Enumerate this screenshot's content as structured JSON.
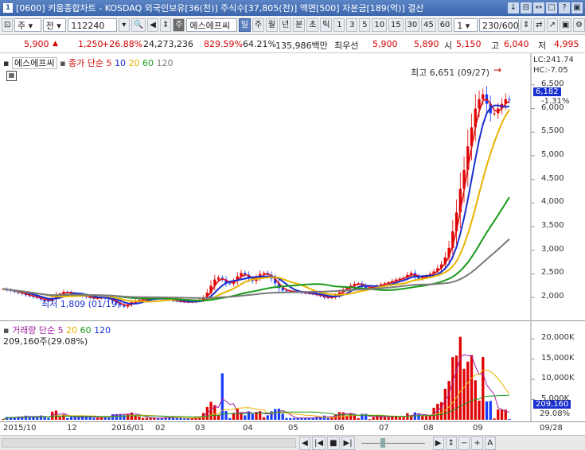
{
  "window": {
    "badge": "1",
    "title": "[0600] 키움종합차트 - KOSDAQ 외국인보유[36(천)] 주식수[37,805(천)] 액면[500] 자본금[189(억)] 결산",
    "buttons": [
      "↓",
      "⊟",
      "↔",
      "□",
      "?",
      "▣"
    ]
  },
  "toolbar": {
    "type_select": "주",
    "jeon_select": "전",
    "code": "112240",
    "company_tag": "주",
    "company": "에스에프씨",
    "periods": [
      "일",
      "주",
      "월",
      "년",
      "분",
      "초",
      "틱"
    ],
    "active_period": "일",
    "intervals": [
      "1",
      "3",
      "5",
      "10",
      "15",
      "30",
      "45",
      "60"
    ],
    "interval_value": "1",
    "count": "230/600"
  },
  "quote": {
    "price": "5,900",
    "change_arrow": "▲",
    "change": "1,250",
    "change_pct": "+26.88%",
    "volume": "24,273,236",
    "vol_ratio": "829.59%",
    "turnover": "64.21%",
    "amount": "135,986백만",
    "best_label": "최우선",
    "bid1": "5,900",
    "bid2": "5,890",
    "open_label": "시",
    "open": "5,150",
    "high_label": "고",
    "high": "6,040",
    "low_label": "저",
    "low": "4,995"
  },
  "price_panel": {
    "stock_name": "에스에프씨",
    "legend_label": "종가 단순",
    "ma_periods": [
      "5",
      "10",
      "20",
      "60",
      "120"
    ],
    "lc": "LC:241.74",
    "hc": "HC:-7.05",
    "current_price": "6,182",
    "current_pct": "-1.31%",
    "high_note": "최고 6,651 (09/27)",
    "low_note": "최저 1,809 (01/19)",
    "y_ticks": [
      "6,500",
      "6,000",
      "5,500",
      "5,000",
      "4,500",
      "4,000",
      "3,500",
      "3,000",
      "2,500",
      "2,000"
    ]
  },
  "volume_panel": {
    "legend_label": "거래량 단순",
    "ma_periods": [
      "5",
      "20",
      "60",
      "120"
    ],
    "current_text": "209,160주(29.08%)",
    "current_volume": "209,160",
    "current_pct": "29.08%",
    "y_ticks": [
      "20,000K",
      "15,000K",
      "10,000K",
      "5,000K"
    ]
  },
  "date_axis": [
    "2015/10",
    "12",
    "2016/01",
    "02",
    "03",
    "04",
    "05",
    "06",
    "07",
    "08",
    "09",
    "09/28"
  ],
  "colors": {
    "up": "#e00000",
    "down": "#1a3cff",
    "ma5": "#e01010",
    "ma10": "#1a2fd0",
    "ma20": "#e8b400",
    "ma60": "#1a9a1a",
    "ma120": "#7a7a7a"
  },
  "chart_data": {
    "type": "line",
    "title": "",
    "price_series": [
      2180,
      2160,
      2140,
      2120,
      2100,
      2080,
      2050,
      2030,
      2010,
      1990,
      1960,
      1940,
      1930,
      1990,
      2060,
      2080,
      2120,
      2110,
      2090,
      2070,
      2050,
      2030,
      2010,
      1990,
      1980,
      1990,
      2010,
      1985,
      1960,
      1920,
      1880,
      1840,
      1809,
      1850,
      1900,
      1930,
      1950,
      1960,
      1970,
      1980,
      1990,
      1985,
      1975,
      1960,
      1945,
      1930,
      1920,
      1910,
      1905,
      1900,
      1910,
      1930,
      1950,
      2000,
      2100,
      2250,
      2380,
      2420,
      2380,
      2300,
      2290,
      2350,
      2450,
      2520,
      2480,
      2400,
      2350,
      2420,
      2500,
      2520,
      2480,
      2400,
      2300,
      2200,
      2150,
      2140,
      2130,
      2120,
      2110,
      2100,
      2090,
      2080,
      2070,
      2050,
      2030,
      2000,
      1990,
      2010,
      2050,
      2110,
      2170,
      2200,
      2250,
      2290,
      2300,
      2250,
      2200,
      2200,
      2220,
      2250,
      2280,
      2300,
      2320,
      2350,
      2380,
      2400,
      2420,
      2480,
      2520,
      2450,
      2400,
      2430,
      2460,
      2500,
      2550,
      2620,
      2700,
      2850,
      3050,
      3400,
      3800,
      4300,
      4700,
      5200,
      5600,
      6000,
      6200,
      6300,
      6100,
      5900,
      5900,
      6000,
      6100,
      6200,
      6182
    ],
    "ma_periods": [
      5,
      10,
      20,
      60,
      120
    ],
    "y_range": [
      1700,
      6800
    ],
    "volume_range": [
      0,
      22000000
    ],
    "volume_peaks": [
      {
        "date": "05",
        "value": 11500000
      },
      {
        "date": "09",
        "value": 20500000
      },
      {
        "date": "09",
        "value": 16000000
      },
      {
        "date": "09",
        "value": 15500000
      }
    ],
    "current_volume": 209160
  }
}
